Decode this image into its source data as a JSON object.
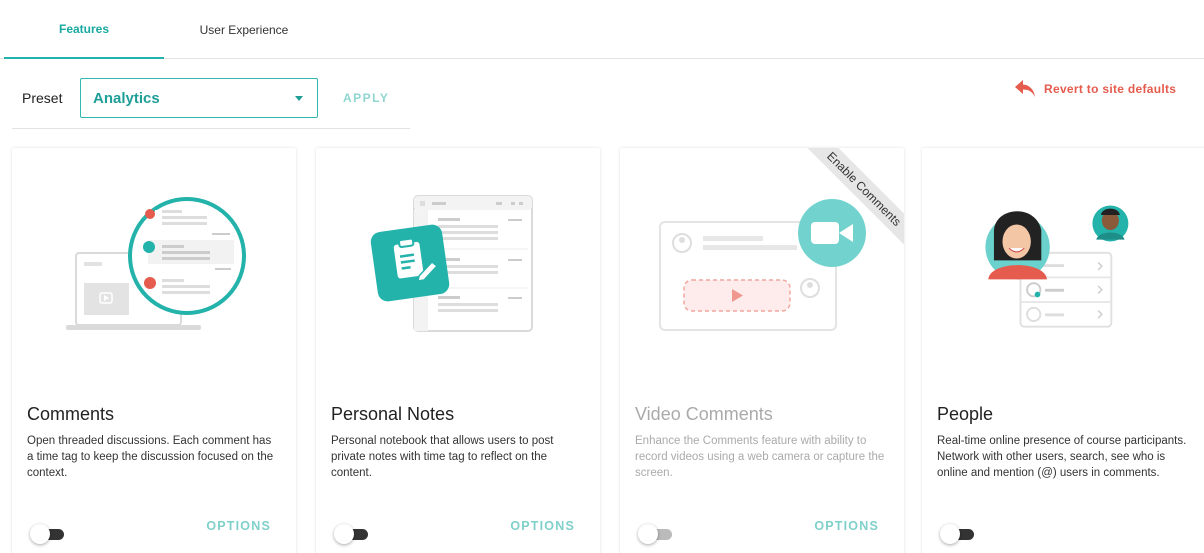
{
  "tabs": [
    {
      "label": "Features",
      "active": true
    },
    {
      "label": "User Experience",
      "active": false
    }
  ],
  "preset": {
    "label": "Preset",
    "selected": "Analytics",
    "apply_label": "APPLY"
  },
  "revert": {
    "label": "Revert to site defaults",
    "icon": "undo-arrow-icon",
    "color": "#e55b4d"
  },
  "accent_color": "#24b3ab",
  "cards": [
    {
      "title": "Comments",
      "description": "Open threaded discussions. Each comment has a time tag to keep the discussion focused on the context.",
      "options_label": "OPTIONS",
      "enabled": false
    },
    {
      "title": "Personal Notes",
      "description": "Personal notebook that allows users to post private notes with time tag to reflect on the content.",
      "options_label": "OPTIONS",
      "enabled": false
    },
    {
      "title": "Video Comments",
      "description": "Enhance the Comments feature with ability to record videos using a web camera or capture the screen.",
      "options_label": "OPTIONS",
      "enabled": false,
      "ribbon": "Enable Comments"
    },
    {
      "title": "People",
      "description": "Real-time online presence of course participants. Network with other users, search, see who is online and mention (@) users in comments.",
      "enabled": false
    }
  ]
}
